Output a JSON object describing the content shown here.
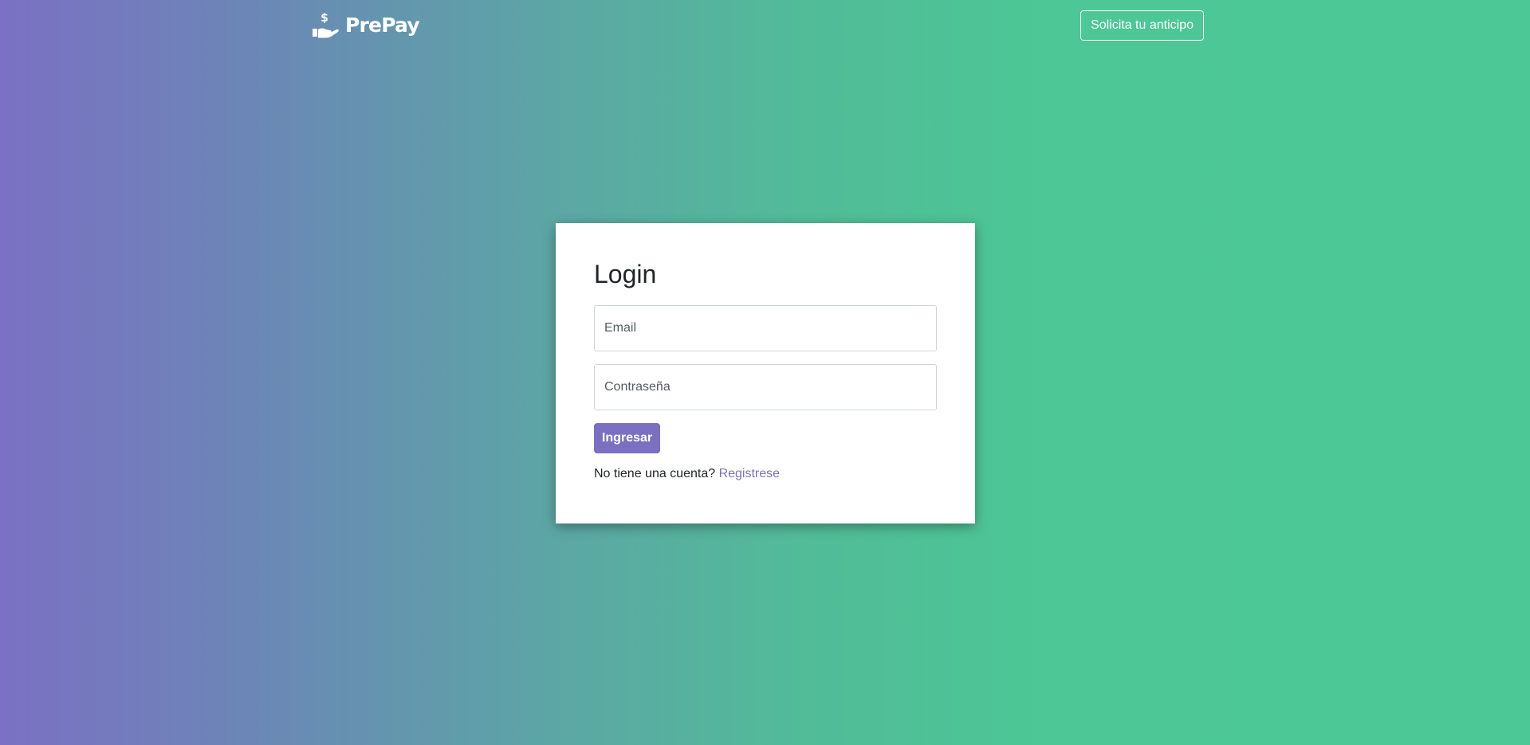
{
  "header": {
    "brand_name": "PrePay",
    "brand_icon": "hand-dollar-icon",
    "cta_label": "Solicita tu anticipo"
  },
  "login": {
    "title": "Login",
    "email_placeholder": "Email",
    "password_placeholder": "Contraseña",
    "submit_label": "Ingresar",
    "signup_prompt": "No tiene una cuenta?",
    "signup_link": "Registrese"
  },
  "colors": {
    "gradient_start": "#7b70c3",
    "gradient_end": "#4bc896",
    "primary_button": "#7b6fc1",
    "link": "#7b70c0"
  }
}
